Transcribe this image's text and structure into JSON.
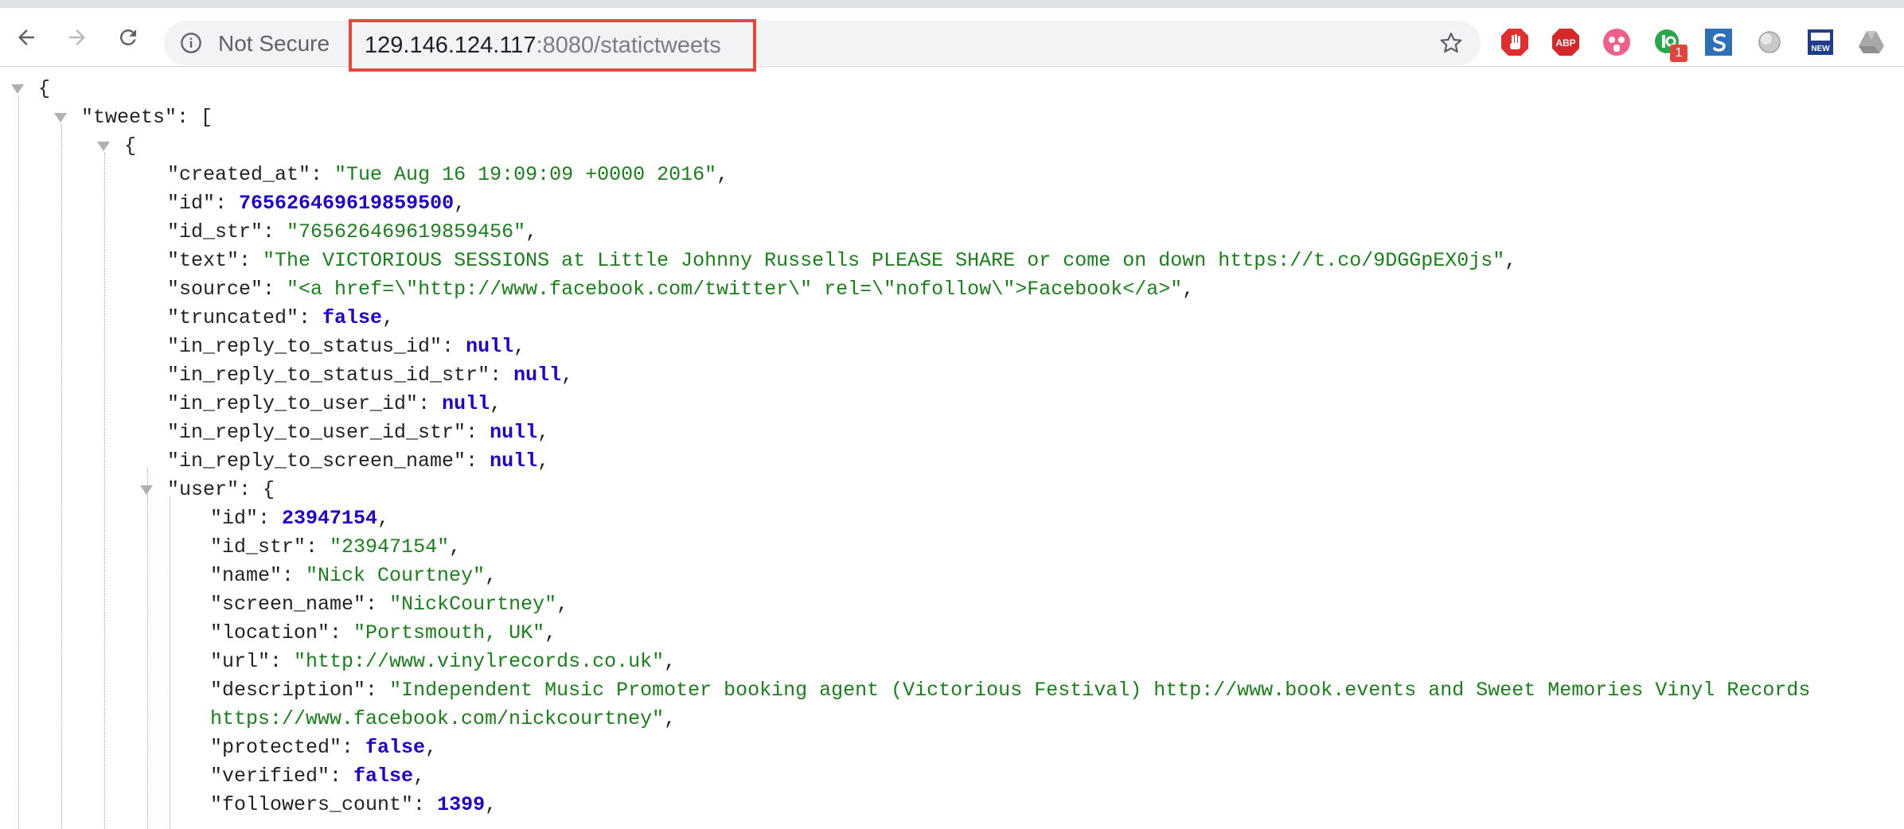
{
  "browser": {
    "security_label": "Not Secure",
    "url_host": "129.146.124.117",
    "url_path": ":8080/statictweets",
    "extensions": [
      {
        "icon": "stop-hand-icon",
        "color": "#e02d2d"
      },
      {
        "icon": "abp-icon",
        "label": "ABP",
        "color": "#d4282b"
      },
      {
        "icon": "pink-ghost-icon",
        "color": "#ee5f8a"
      },
      {
        "icon": "green-circle-icon",
        "badge": "1",
        "color": "#2aa64b"
      },
      {
        "icon": "s-square-icon",
        "color": "#2d70b8"
      },
      {
        "icon": "gray-sphere-icon",
        "color": "#9e9e9e"
      },
      {
        "icon": "new-icon",
        "label": "NEW",
        "color": "#1f3d8a"
      },
      {
        "icon": "drive-triangle-icon",
        "color": "#9e9e9e"
      }
    ]
  },
  "json": {
    "root_key": "\"tweets\"",
    "tweet": {
      "created_at": {
        "key": "\"created_at\"",
        "value": "\"Tue Aug 16 19:09:09 +0000 2016\""
      },
      "id": {
        "key": "\"id\"",
        "value": "765626469619859500"
      },
      "id_str": {
        "key": "\"id_str\"",
        "value": "\"765626469619859456\""
      },
      "text": {
        "key": "\"text\"",
        "value": "\"The VICTORIOUS SESSIONS at Little Johnny Russells PLEASE SHARE or come on down https://t.co/9DGGpEX0js\""
      },
      "source": {
        "key": "\"source\"",
        "value": "\"<a href=\\\"http://www.facebook.com/twitter\\\" rel=\\\"nofollow\\\">Facebook</a>\""
      },
      "truncated": {
        "key": "\"truncated\"",
        "value": "false"
      },
      "in_reply_to_status_id": {
        "key": "\"in_reply_to_status_id\"",
        "value": "null"
      },
      "in_reply_to_status_id_str": {
        "key": "\"in_reply_to_status_id_str\"",
        "value": "null"
      },
      "in_reply_to_user_id": {
        "key": "\"in_reply_to_user_id\"",
        "value": "null"
      },
      "in_reply_to_user_id_str": {
        "key": "\"in_reply_to_user_id_str\"",
        "value": "null"
      },
      "in_reply_to_screen_name": {
        "key": "\"in_reply_to_screen_name\"",
        "value": "null"
      },
      "user_key": "\"user\""
    },
    "user": {
      "id": {
        "key": "\"id\"",
        "value": "23947154"
      },
      "id_str": {
        "key": "\"id_str\"",
        "value": "\"23947154\""
      },
      "name": {
        "key": "\"name\"",
        "value": "\"Nick Courtney\""
      },
      "screen_name": {
        "key": "\"screen_name\"",
        "value": "\"NickCourtney\""
      },
      "location": {
        "key": "\"location\"",
        "value": "\"Portsmouth, UK\""
      },
      "url": {
        "key": "\"url\"",
        "value": "\"http://www.vinylrecords.co.uk\""
      },
      "description": {
        "key": "\"description\"",
        "value_line1": "\"Independent Music Promoter booking agent (Victorious Festival) http://www.book.events and Sweet Memories Vinyl Records",
        "value_line2": "https://www.facebook.com/nickcourtney\""
      },
      "protected": {
        "key": "\"protected\"",
        "value": "false"
      },
      "verified": {
        "key": "\"verified\"",
        "value": "false"
      },
      "followers_count": {
        "key": "\"followers_count\"",
        "value": "1399"
      }
    }
  }
}
